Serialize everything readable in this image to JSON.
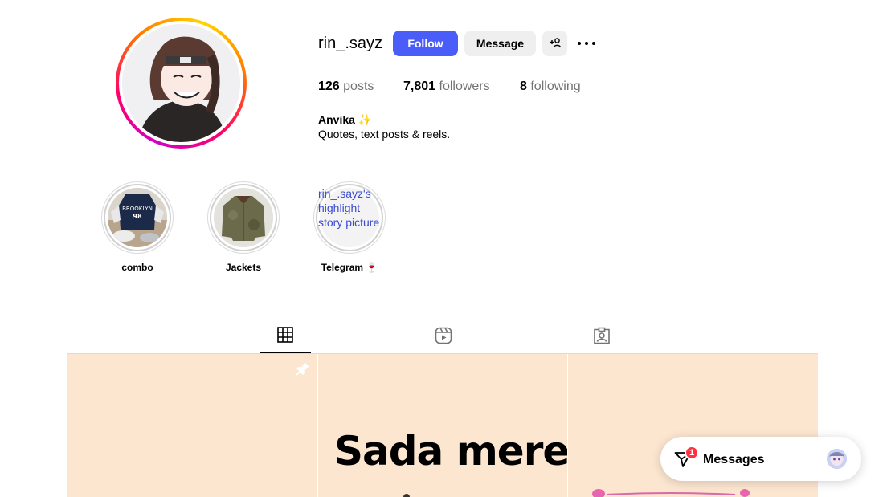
{
  "profile": {
    "username": "rin_.sayz",
    "buttons": {
      "follow": "Follow",
      "message": "Message"
    },
    "stats": {
      "posts_count": "126",
      "posts_label": "posts",
      "followers_count": "7,801",
      "followers_label": "followers",
      "following_count": "8",
      "following_label": "following"
    },
    "bio": {
      "name": "Anvika",
      "name_emoji": "✨",
      "text": "Quotes, text posts & reels."
    }
  },
  "highlights": [
    {
      "label": "combo"
    },
    {
      "label": "Jackets"
    },
    {
      "label": "Telegram 🍷",
      "broken_image_alt": "rin_.sayz's highlight story picture"
    }
  ],
  "tabs": [
    {
      "icon": "grid-icon",
      "active": true
    },
    {
      "icon": "reels-icon",
      "active": false
    },
    {
      "icon": "tagged-icon",
      "active": false
    }
  ],
  "posts": [
    {
      "pinned": true,
      "text": ""
    },
    {
      "pinned": false,
      "text": "Sada mere"
    },
    {
      "pinned": false,
      "text": ""
    }
  ],
  "messages_widget": {
    "label": "Messages",
    "unread_count": "1"
  },
  "colors": {
    "accent": "#4a5df9",
    "post_bg": "#fce6d0",
    "badge": "#ff3040"
  }
}
